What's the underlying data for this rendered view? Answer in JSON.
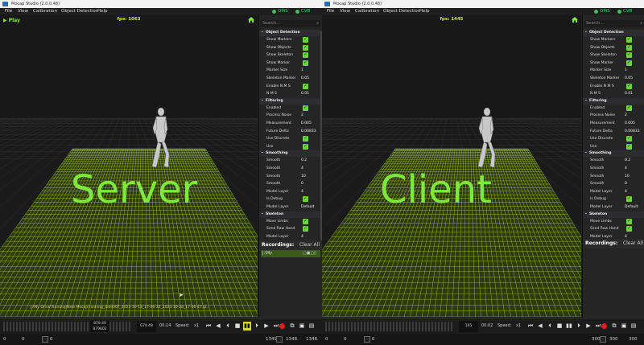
{
  "windows": [
    {
      "id": "left",
      "title": "Mocap Studio (2.0.0.48)",
      "menu": [
        "File",
        "View",
        "Calibration",
        "Object Detection",
        "Help"
      ],
      "status": [
        {
          "label": "OMS"
        },
        {
          "label": "CVB"
        }
      ],
      "play_label": "Play",
      "fps_label": "fps: 1063",
      "overlay_label": "Server",
      "path_text": "J:\\My Drive\\Training\\New Mocap\\running_take007_2023-10-18_17-06-32_2023-10-18_17-06-47.gl...",
      "search_placeholder": "Search...",
      "sections": [
        {
          "title": "Object Detection",
          "rows": [
            {
              "label": "Show Markers",
              "check": true
            },
            {
              "label": "Show Objects",
              "check": true
            },
            {
              "label": "Show Skeleton",
              "check": true
            },
            {
              "label": "Show Marker",
              "check": true
            },
            {
              "label": "Marker Size",
              "value": "1"
            },
            {
              "label": "Skeleton Marker",
              "value": "0.05"
            },
            {
              "label": "Enable N M S",
              "check": true
            },
            {
              "label": "N M S",
              "value": "0.01"
            }
          ]
        },
        {
          "title": "Filtering",
          "rows": [
            {
              "label": "Enabled",
              "check": true
            },
            {
              "label": "Process Noise",
              "value": "2"
            },
            {
              "label": "Measurement",
              "value": "0.005"
            },
            {
              "label": "Future Delta",
              "value": "0.00833"
            },
            {
              "label": "Use Discrete",
              "check": true
            },
            {
              "label": "Use",
              "check": true
            }
          ]
        },
        {
          "title": "Smoothing",
          "rows": [
            {
              "label": "Smooth",
              "value": "0.2"
            },
            {
              "label": "Smooth",
              "value": "4"
            },
            {
              "label": "Smooth",
              "value": "10"
            },
            {
              "label": "Smooth",
              "value": "0"
            },
            {
              "label": "Model Layer",
              "value": "4"
            },
            {
              "label": "Is Debug",
              "check": true
            },
            {
              "label": "Model Layer",
              "value": "Default"
            }
          ]
        },
        {
          "title": "Skeleton",
          "rows": [
            {
              "label": "Move Limbs",
              "check": true
            },
            {
              "label": "Send Raw Hand",
              "check": true
            },
            {
              "label": "Model Layer",
              "value": "4"
            }
          ]
        }
      ],
      "recordings_label": "Recordings:",
      "clear_all": "Clear All",
      "recording_item": "J:\\My",
      "frame_top": "879.49",
      "frame_bottom": "879602",
      "frame_box": "679.49",
      "time": "00:14",
      "speed_label": "Speed:",
      "speed_value": "x1",
      "bottom": {
        "a": "0",
        "b": "0",
        "c": "0",
        "d": "1349",
        "e": "1348.",
        "f": "1348."
      }
    },
    {
      "id": "right",
      "title": "Mocap Studio (2.0.0.48)",
      "menu": [
        "File",
        "View",
        "Calibration",
        "Object Detection",
        "Help"
      ],
      "status": [
        {
          "label": "OMS"
        },
        {
          "label": "CVB"
        }
      ],
      "fps_label": "fps: 1445",
      "overlay_label": "Client",
      "search_placeholder": "Search...",
      "sections": [
        {
          "title": "Object Detection",
          "rows": [
            {
              "label": "Show Markers",
              "check": true
            },
            {
              "label": "Show Objects",
              "check": true
            },
            {
              "label": "Show Skeleton",
              "check": true
            },
            {
              "label": "Show Marker",
              "check": true
            },
            {
              "label": "Marker Size",
              "value": "1"
            },
            {
              "label": "Skeleton Marker",
              "value": "0.05"
            },
            {
              "label": "Enable N M S",
              "check": true
            },
            {
              "label": "N M S",
              "value": "0.01"
            }
          ]
        },
        {
          "title": "Filtering",
          "rows": [
            {
              "label": "Enabled",
              "check": true
            },
            {
              "label": "Process Noise",
              "value": "2"
            },
            {
              "label": "Measurement",
              "value": "0.005"
            },
            {
              "label": "Future Delta",
              "value": "0.00833"
            },
            {
              "label": "Use Discrete",
              "check": true
            },
            {
              "label": "Use",
              "check": true
            }
          ]
        },
        {
          "title": "Smoothing",
          "rows": [
            {
              "label": "Smooth",
              "value": "0.2"
            },
            {
              "label": "Smooth",
              "value": "4"
            },
            {
              "label": "Smooth",
              "value": "10"
            },
            {
              "label": "Smooth",
              "value": "0"
            },
            {
              "label": "Model Layer",
              "value": "4"
            },
            {
              "label": "Is Debug",
              "check": true
            },
            {
              "label": "Model Layer",
              "value": "Default"
            }
          ]
        },
        {
          "title": "Skeleton",
          "rows": [
            {
              "label": "Move Limbs",
              "check": true
            },
            {
              "label": "Send Raw Hand",
              "check": true
            },
            {
              "label": "Model Layer",
              "value": "4"
            }
          ]
        }
      ],
      "recordings_label": "Recordings:",
      "clear_all": "Clear All",
      "frame_box": "165",
      "time": "00:02",
      "speed_label": "Speed:",
      "speed_value": "x1",
      "bottom": {
        "a": "0",
        "b": "0",
        "c": "0",
        "d": "300",
        "e": "300",
        "f": "300"
      }
    }
  ],
  "colors": {
    "accent_green": "#7ee83c",
    "grid_green": "#a6d12a",
    "checkbox": "#6ad43a",
    "record_red": "#e02020"
  }
}
